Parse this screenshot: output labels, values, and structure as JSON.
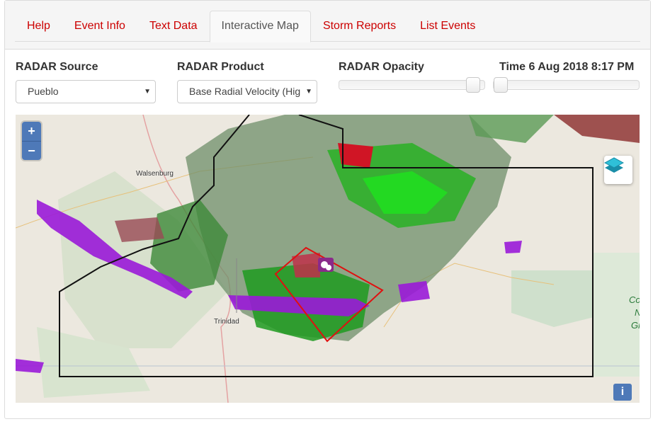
{
  "tabs": [
    {
      "label": "Help",
      "active": false
    },
    {
      "label": "Event Info",
      "active": false
    },
    {
      "label": "Text Data",
      "active": false
    },
    {
      "label": "Interactive Map",
      "active": true
    },
    {
      "label": "Storm Reports",
      "active": false
    },
    {
      "label": "List Events",
      "active": false
    }
  ],
  "controls": {
    "radar_source_label": "RADAR Source",
    "radar_source_value": "Pueblo",
    "radar_product_label": "RADAR Product",
    "radar_product_value": "Base Radial Velocity (Hig",
    "radar_opacity_label": "RADAR Opacity",
    "radar_opacity_fraction": 0.97,
    "time_label": "Time 6 Aug 2018 8:17 PM",
    "time_fraction": 0.0
  },
  "map": {
    "zoom_in_label": "+",
    "zoom_out_label": "−",
    "info_label": "i",
    "layers_icon": "layers-icon",
    "towns": [
      "Walsenburg",
      "Trinidad"
    ],
    "grassland_lines": [
      "Co",
      "N",
      "Gr"
    ],
    "colors": {
      "inbound": "#10b010",
      "outbound": "#c00010",
      "range_folded": "#9a1ad8",
      "warning_polygon": "#e01010",
      "county_line": "#111111"
    }
  }
}
